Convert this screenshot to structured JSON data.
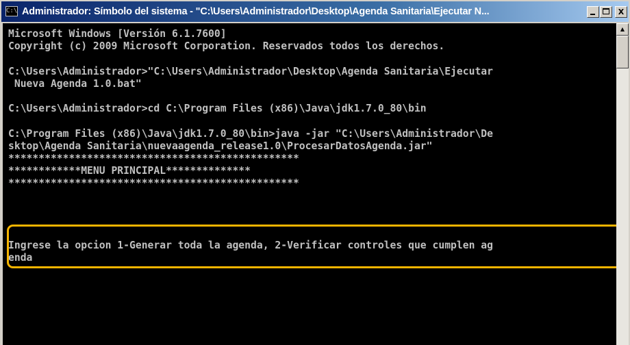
{
  "window": {
    "title": "Administrador: Símbolo del sistema - \"C:\\Users\\Administrador\\Desktop\\Agenda Sanitaria\\Ejecutar N...",
    "icon_text": "C:\\",
    "controls": {
      "minimize_icon": "minimize-icon",
      "maximize_icon": "maximize-icon",
      "close_label": "X"
    }
  },
  "console": {
    "lines": [
      "Microsoft Windows [Versión 6.1.7600]",
      "Copyright (c) 2009 Microsoft Corporation. Reservados todos los derechos.",
      "",
      "C:\\Users\\Administrador>\"C:\\Users\\Administrador\\Desktop\\Agenda Sanitaria\\Ejecutar",
      " Nueva Agenda 1.0.bat\"",
      "",
      "C:\\Users\\Administrador>cd C:\\Program Files (x86)\\Java\\jdk1.7.0_80\\bin",
      "",
      "C:\\Program Files (x86)\\Java\\jdk1.7.0_80\\bin>java -jar \"C:\\Users\\Administrador\\De",
      "sktop\\Agenda Sanitaria\\nuevaagenda_release1.0\\ProcesarDatosAgenda.jar\"",
      "************************************************",
      "************MENU PRINCIPAL**************",
      "************************************************",
      "",
      "",
      "",
      "",
      "Ingrese la opcion 1-Generar toda la agenda, 2-Verificar controles que cumplen ag",
      "enda"
    ]
  },
  "colors": {
    "console_background": "#000000",
    "console_text": "#c0c0c0",
    "highlight": "#f5b400",
    "title_gradient_start": "#0a246a"
  },
  "scrollbar": {
    "up_arrow": "▲"
  }
}
